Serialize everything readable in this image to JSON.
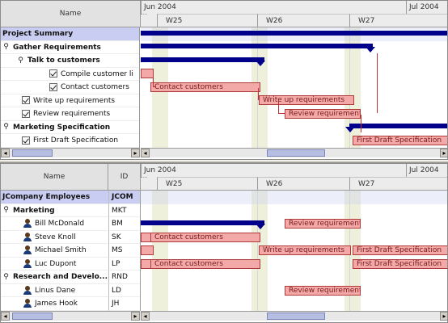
{
  "top": {
    "header": {
      "name": "Name"
    },
    "timeline": {
      "months": [
        {
          "label": "Jun 2004"
        },
        {
          "label": "Jul 2004"
        }
      ],
      "weeks": [
        {
          "label": "W25"
        },
        {
          "label": "W26"
        },
        {
          "label": "W27"
        }
      ]
    },
    "rows": [
      {
        "label": "Project Summary",
        "kind": "summary",
        "icon": "none"
      },
      {
        "label": "Gather Requirements",
        "kind": "bold",
        "icon": "tree-expanded"
      },
      {
        "label": "Talk to customers",
        "kind": "bold",
        "icon": "tree-expanded"
      },
      {
        "label": "Compile customer li",
        "kind": "task",
        "icon": "check"
      },
      {
        "label": "Contact customers",
        "kind": "task",
        "icon": "check"
      },
      {
        "label": "Write up requirements",
        "kind": "task",
        "icon": "check"
      },
      {
        "label": "Review requirements",
        "kind": "task",
        "icon": "check"
      },
      {
        "label": "Marketing Specification",
        "kind": "bold",
        "icon": "tree-expanded"
      },
      {
        "label": "First Draft Specification",
        "kind": "task",
        "icon": "check"
      }
    ],
    "bars": [
      {
        "label": "Contact customers"
      },
      {
        "label": "Write up requirements"
      },
      {
        "label": "Review requirements"
      },
      {
        "label": "First Draft Specification"
      }
    ]
  },
  "bottom": {
    "header": {
      "name": "Name",
      "id": "ID"
    },
    "timeline": {
      "months": [
        {
          "label": "Jun 2004"
        },
        {
          "label": "Jul 2004"
        }
      ],
      "weeks": [
        {
          "label": "W25"
        },
        {
          "label": "W26"
        },
        {
          "label": "W27"
        }
      ]
    },
    "rows": [
      {
        "label": "JCompany Employees",
        "id": "JCOM",
        "kind": "summary",
        "icon": "none"
      },
      {
        "label": "Marketing",
        "id": "MKT",
        "kind": "bold",
        "icon": "tree-expanded"
      },
      {
        "label": "Bill McDonald",
        "id": "BM",
        "kind": "person",
        "icon": "person"
      },
      {
        "label": "Steve Knoll",
        "id": "SK",
        "kind": "person",
        "icon": "person"
      },
      {
        "label": "Michael Smith",
        "id": "MS",
        "kind": "person",
        "icon": "person"
      },
      {
        "label": "Luc Dupont",
        "id": "LP",
        "kind": "person",
        "icon": "person"
      },
      {
        "label": "Research and Develo...",
        "id": "RND",
        "kind": "bold",
        "icon": "tree-expanded"
      },
      {
        "label": "Linus Dane",
        "id": "LD",
        "kind": "person",
        "icon": "person"
      },
      {
        "label": "James Hook",
        "id": "JH",
        "kind": "person",
        "icon": "person"
      }
    ],
    "bars": [
      {
        "label": "Review requirements"
      },
      {
        "label": "Contact customers"
      },
      {
        "label": "Write up requirements"
      },
      {
        "label": "First Draft Specification"
      },
      {
        "label": "Contact customers"
      },
      {
        "label": "First Draft Specification"
      },
      {
        "label": "Review requirements"
      }
    ]
  },
  "scroll": {
    "left_arrow": "◂",
    "right_arrow": "▸"
  },
  "colors": {
    "summary_row": "#c9cdf2",
    "summary_bar": "#00008b",
    "task_bar": "#f4a9a9",
    "task_border": "#b03a3a"
  }
}
